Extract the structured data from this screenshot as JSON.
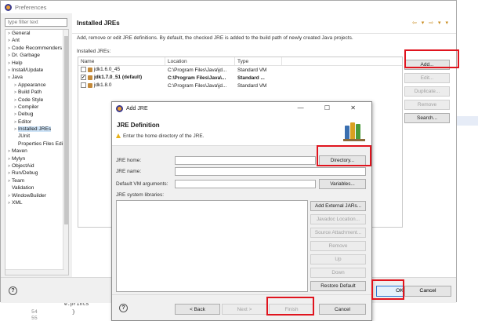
{
  "preferences": {
    "title": "Preferences",
    "filter_placeholder": "type filter text",
    "tree": [
      {
        "label": "General",
        "indent": 0,
        "twisty": ">"
      },
      {
        "label": "Ant",
        "indent": 0,
        "twisty": ">"
      },
      {
        "label": "Code Recommenders",
        "indent": 0,
        "twisty": ">"
      },
      {
        "label": "Dr. Garbage",
        "indent": 0,
        "twisty": ">"
      },
      {
        "label": "Help",
        "indent": 0,
        "twisty": ">"
      },
      {
        "label": "Install/Update",
        "indent": 0,
        "twisty": ">"
      },
      {
        "label": "Java",
        "indent": 0,
        "twisty": "v"
      },
      {
        "label": "Appearance",
        "indent": 1,
        "twisty": ">"
      },
      {
        "label": "Build Path",
        "indent": 1,
        "twisty": ">"
      },
      {
        "label": "Code Style",
        "indent": 1,
        "twisty": ">"
      },
      {
        "label": "Compiler",
        "indent": 1,
        "twisty": ">"
      },
      {
        "label": "Debug",
        "indent": 1,
        "twisty": ">"
      },
      {
        "label": "Editor",
        "indent": 1,
        "twisty": ">"
      },
      {
        "label": "Installed JREs",
        "indent": 1,
        "twisty": ">",
        "selected": true
      },
      {
        "label": "JUnit",
        "indent": 1,
        "twisty": ""
      },
      {
        "label": "Properties Files Edi",
        "indent": 1,
        "twisty": ""
      },
      {
        "label": "Maven",
        "indent": 0,
        "twisty": ">"
      },
      {
        "label": "Mylyn",
        "indent": 0,
        "twisty": ">"
      },
      {
        "label": "ObjectAid",
        "indent": 0,
        "twisty": ">"
      },
      {
        "label": "Run/Debug",
        "indent": 0,
        "twisty": ">"
      },
      {
        "label": "Team",
        "indent": 0,
        "twisty": ">"
      },
      {
        "label": "Validation",
        "indent": 0,
        "twisty": ""
      },
      {
        "label": "WindowBuilder",
        "indent": 0,
        "twisty": ">"
      },
      {
        "label": "XML",
        "indent": 0,
        "twisty": ">"
      }
    ],
    "page_title": "Installed JREs",
    "nav_arrows": "⇦ ▾ ⇨ ▾ ▾",
    "description": "Add, remove or edit JRE definitions. By default, the checked JRE is added to the build path of newly created Java projects.",
    "installed_label": "Installed JREs:",
    "columns": [
      "Name",
      "Location",
      "Type"
    ],
    "rows": [
      {
        "checked": false,
        "name": "jdk1.6.0_45",
        "location": "C:\\Program Files\\Java\\jd...",
        "type": "Standard VM",
        "bold": false
      },
      {
        "checked": true,
        "name": "jdk1.7.0_51 (default)",
        "location": "C:\\Program Files\\Java\\...",
        "type": "Standard ...",
        "bold": true
      },
      {
        "checked": false,
        "name": "jdk1.8.0",
        "location": "C:\\Program Files\\Java\\jd...",
        "type": "Standard VM",
        "bold": false
      }
    ],
    "buttons": {
      "add": "Add...",
      "edit": "Edit...",
      "duplicate": "Duplicate...",
      "remove": "Remove",
      "search": "Search..."
    },
    "footer": {
      "help": "?",
      "ok": "OK",
      "cancel": "Cancel"
    }
  },
  "add_jre": {
    "title": "Add JRE",
    "heading": "JRE Definition",
    "hint": "Enter the home directory of the JRE.",
    "jre_home_label": "JRE home:",
    "jre_home_value": "",
    "directory_button": "Directory...",
    "jre_name_label": "JRE name:",
    "jre_name_value": "",
    "vm_args_label": "Default VM arguments:",
    "vm_args_value": "",
    "variables_button": "Variables...",
    "libraries_label": "JRE system libraries:",
    "lib_buttons": {
      "add_external": "Add External JARs...",
      "javadoc": "Javadoc Location...",
      "source": "Source Attachment...",
      "remove": "Remove",
      "up": "Up",
      "down": "Down",
      "restore": "Restore Default"
    },
    "footer": {
      "help": "?",
      "back": "< Back",
      "next": "Next >",
      "finish": "Finish",
      "cancel": "Cancel"
    },
    "window_controls": "—  ☐  ✕"
  },
  "editor_bg": {
    "lines": [
      "54",
      "55"
    ],
    "code": [
      "e.printS",
      "}"
    ]
  },
  "colors": {
    "highlight": "#e0141e",
    "selection": "#cde3f7",
    "primary_border": "#2a75d1"
  }
}
